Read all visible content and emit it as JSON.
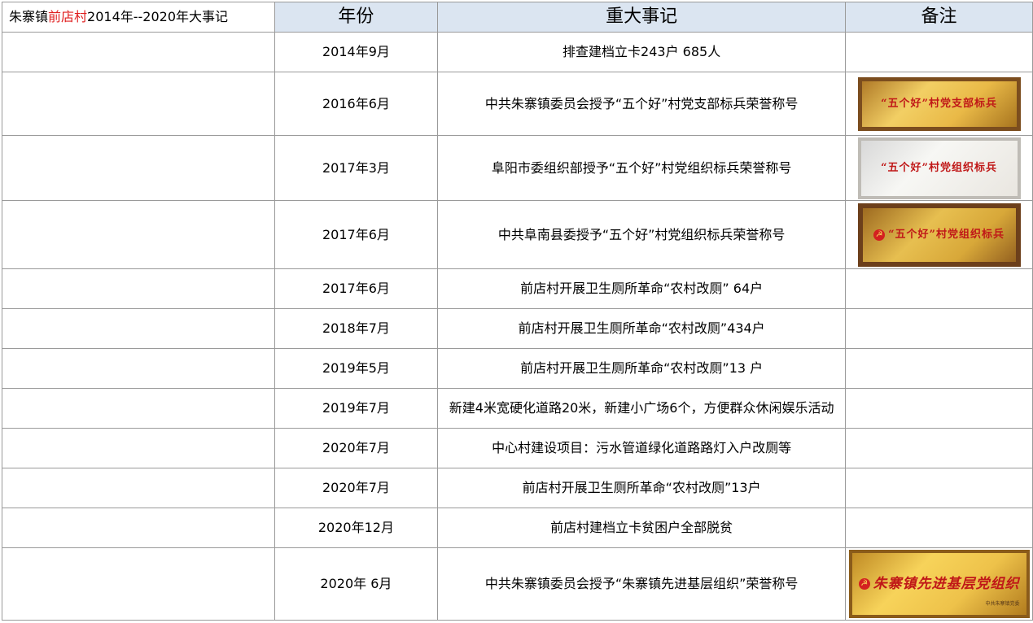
{
  "header": {
    "title_prefix": "朱寨镇",
    "title_highlight": "前店村",
    "title_suffix": "2014年--2020年大事记",
    "col_year": "年份",
    "col_event": "重大事记",
    "col_note": "备注"
  },
  "colors": {
    "header_bg": "#dbe5f1",
    "highlight": "#e02020",
    "grid": "#9a9a9a"
  },
  "rows": [
    {
      "year": "2014年9月",
      "event": "排查建档立卡243户  685人"
    },
    {
      "year": "2016年6月",
      "event": "中共朱寨镇委员会授予“五个好”村党支部标兵荣誉称号"
    },
    {
      "year": "2017年3月",
      "event": "阜阳市委组织部授予“五个好”村党组织标兵荣誉称号"
    },
    {
      "year": "2017年6月",
      "event": "中共阜南县委授予“五个好”村党组织标兵荣誉称号"
    },
    {
      "year": "2017年6月",
      "event": "前店村开展卫生厕所革命“农村改厕”  64户"
    },
    {
      "year": "2018年7月",
      "event": "前店村开展卫生厕所革命“农村改厕”434户"
    },
    {
      "year": "2019年5月",
      "event": "前店村开展卫生厕所革命“农村改厕”13 户"
    },
    {
      "year": "2019年7月",
      "event": "新建4米宽硬化道路20米，新建小广场6个，方便群众休闲娱乐活动"
    },
    {
      "year": "2020年7月",
      "event": "中心村建设项目：污水管道绿化道路路灯入户改厕等"
    },
    {
      "year": "2020年7月",
      "event": "前店村开展卫生厕所革命“农村改厕”13户"
    },
    {
      "year": "2020年12月",
      "event": "前店村建档立卡贫困户全部脱贫"
    },
    {
      "year": "2020年 6月",
      "event": "中共朱寨镇委员会授予“朱寨镇先进基层组织”荣誉称号"
    }
  ],
  "plaques": [
    {
      "icon": "gold-plaque-photo",
      "text": "“五个好”村党支部标兵"
    },
    {
      "icon": "silver-plaque-photo",
      "text": "“五个好”村党组织标兵"
    },
    {
      "icon": "gold-plaque-photo",
      "text": "“五个好”村党组织标兵"
    },
    {
      "icon": "gold-plaque-photo",
      "text": "朱寨镇先进基层党组织",
      "footer": "中共朱寨镇党委"
    }
  ]
}
